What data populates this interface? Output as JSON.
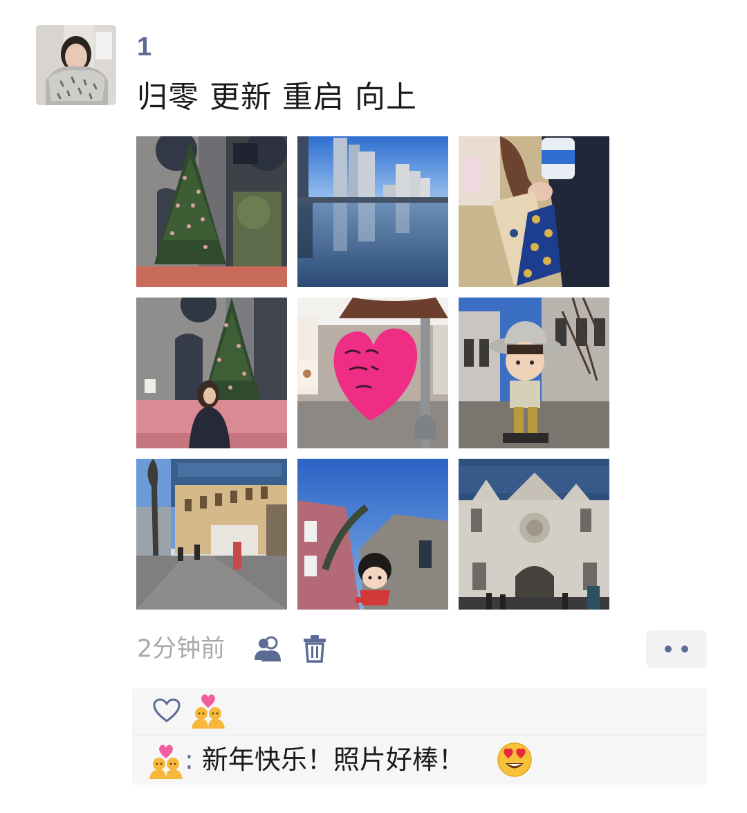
{
  "post": {
    "username": "1",
    "text": "归零 更新 重启 向上",
    "time": "2分钟前"
  },
  "photos": [
    {
      "subject": "christmas-tree-building"
    },
    {
      "subject": "city-river-skyline"
    },
    {
      "subject": "paper-bag-drink"
    },
    {
      "subject": "person-by-christmas-tree"
    },
    {
      "subject": "pink-heart-sign"
    },
    {
      "subject": "figure-statue-hat"
    },
    {
      "subject": "street-yellow-building"
    },
    {
      "subject": "building-with-cartoon-balloon"
    },
    {
      "subject": "ornate-facade-building"
    }
  ],
  "icons": {
    "privacy": "people-icon",
    "delete": "trash-icon",
    "more": "more-dots-icon",
    "like": "heart-outline-icon"
  },
  "likes": {
    "users": [
      "couple-with-heart-emoji-avatar"
    ]
  },
  "comments": [
    {
      "author_avatar": "couple-with-heart-emoji-avatar",
      "separator": ":",
      "text": " 新年快乐！照片好棒！",
      "trailing_emoji": "smiling-face-with-heart-eyes"
    }
  ],
  "colors": {
    "link_blue": "#5b6b93",
    "time_gray": "#a9a9a9",
    "box_bg": "#f6f6f6"
  }
}
